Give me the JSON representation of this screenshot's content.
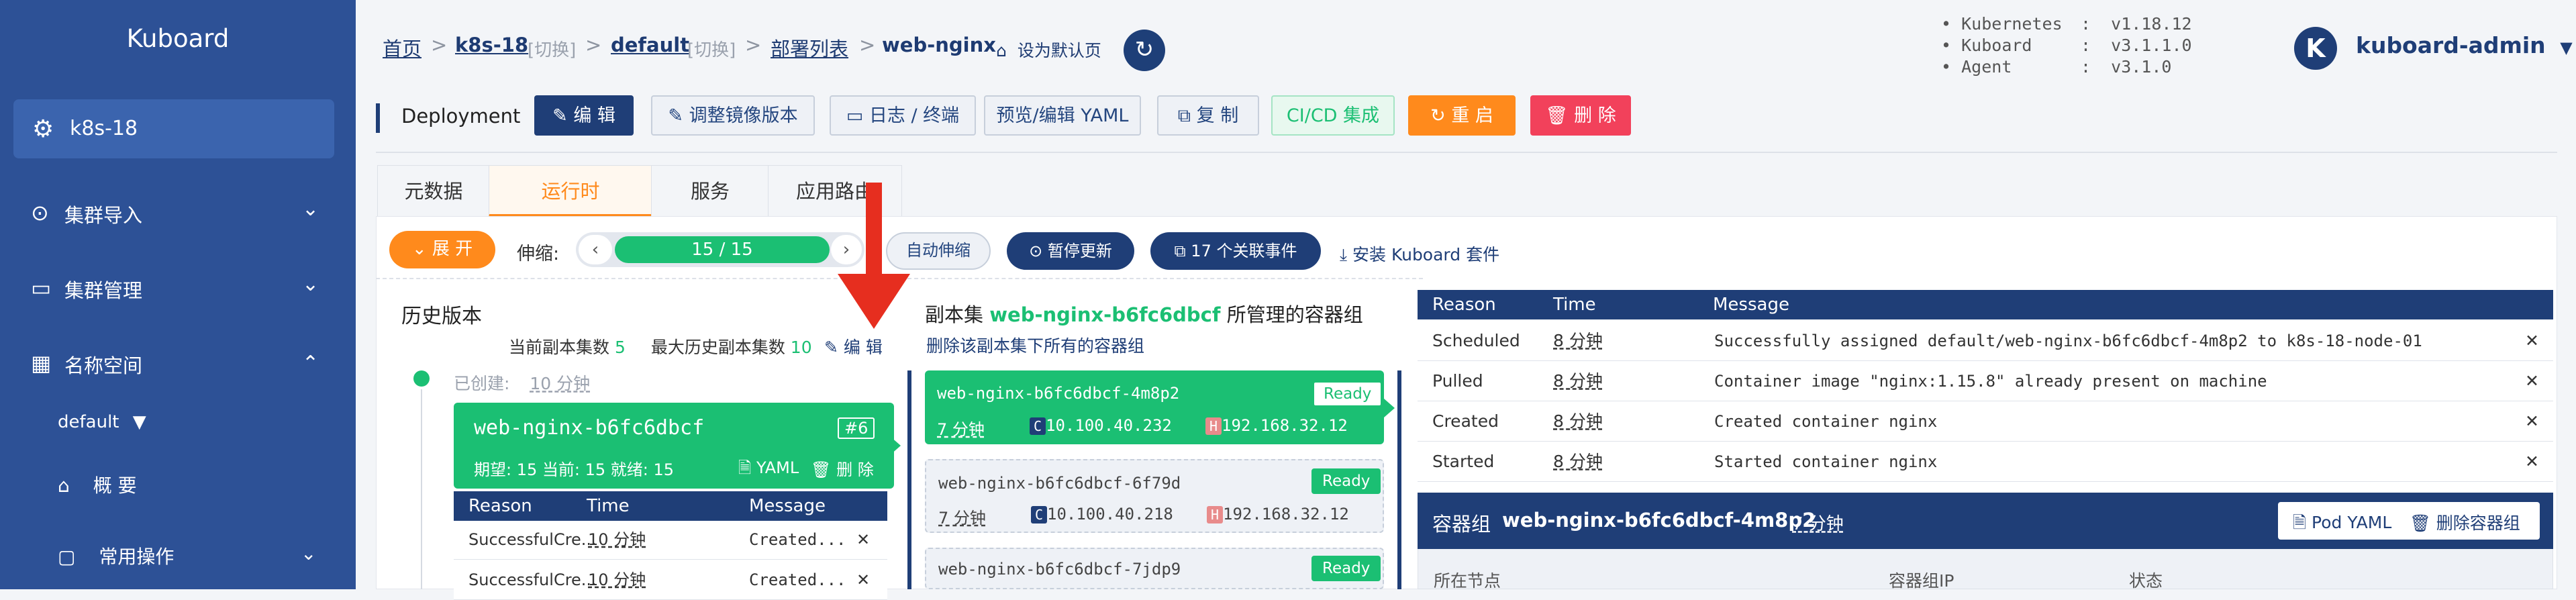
{
  "sidebar": {
    "title": "Kuboard",
    "cluster": "k8s-18",
    "items": [
      {
        "label": "集群导入",
        "icon": "link-icon"
      },
      {
        "label": "集群管理",
        "icon": "server-icon"
      },
      {
        "label": "名称空间",
        "icon": "grid-icon"
      }
    ],
    "namespace": "default",
    "overview": "概 要",
    "common_ops": "常用操作"
  },
  "breadcrumb": {
    "home": "首页",
    "cluster": "k8s-18",
    "switch1": "[切换]",
    "ns": "default",
    "switch2": "[切换]",
    "deploy_list": "部署列表",
    "current": "web-nginx",
    "set_default": "设为默认页"
  },
  "versions": [
    {
      "name": "Kubernetes",
      "value": "v1.18.12"
    },
    {
      "name": "Kuboard",
      "value": "v3.1.1.0"
    },
    {
      "name": "Agent",
      "value": "v3.1.0"
    }
  ],
  "user": {
    "initial": "K",
    "name": "kuboard-admin"
  },
  "toolbar": {
    "kind": "Deployment",
    "edit": "编 辑",
    "image": "调整镜像版本",
    "logs": "日志 / 终端",
    "yaml": "预览/编辑 YAML",
    "copy": "复 制",
    "cicd": "CI/CD 集成",
    "restart": "重 启",
    "delete": "删 除"
  },
  "tabs": [
    "元数据",
    "运行时",
    "服务",
    "应用路由"
  ],
  "runtime": {
    "expand": "展 开",
    "scale_label": "伸缩:",
    "scale_value": "15 / 15",
    "autoscale": "自动伸缩",
    "pause": "暂停更新",
    "events": "17 个关联事件",
    "install": "安装 Kuboard 套件"
  },
  "history": {
    "title": "历史版本",
    "current_label": "当前副本集数",
    "current_value": "5",
    "max_label": "最大历史副本集数",
    "max_value": "10",
    "edit": "编 辑",
    "created_label": "已创建:",
    "created_value": "10 分钟",
    "rs_name": "web-nginx-b6fc6dbcf",
    "rs_rev": "#6",
    "rs_stats": "期望: 15  当前: 15  就绪: 15",
    "rs_yaml": "YAML",
    "rs_delete": "删 除",
    "table_head": [
      "Reason",
      "Time",
      "Message"
    ],
    "rows": [
      {
        "reason": "SuccessfulCre...",
        "time": "10 分钟",
        "message": "Created..."
      },
      {
        "reason": "SuccessfulCre...",
        "time": "10 分钟",
        "message": "Created..."
      }
    ]
  },
  "pods": {
    "title_prefix": "副本集",
    "rs_name": "web-nginx-b6fc6dbcf",
    "title_suffix": "所管理的容器组",
    "delete_all": "删除该副本集下所有的容器组",
    "ready": "Ready",
    "list": [
      {
        "name": "web-nginx-b6fc6dbcf-4m8p2",
        "age": "7 分钟",
        "cip": "10.100.40.232",
        "hip": "192.168.32.12"
      },
      {
        "name": "web-nginx-b6fc6dbcf-6f79d",
        "age": "7 分钟",
        "cip": "10.100.40.218",
        "hip": "192.168.32.12"
      },
      {
        "name": "web-nginx-b6fc6dbcf-7jdp9",
        "age": "",
        "cip": "",
        "hip": ""
      }
    ]
  },
  "events": {
    "head": [
      "Reason",
      "Time",
      "Message"
    ],
    "rows": [
      {
        "reason": "Scheduled",
        "time": "8 分钟",
        "message": "Successfully assigned default/web-nginx-b6fc6dbcf-4m8p2 to k8s-18-node-01"
      },
      {
        "reason": "Pulled",
        "time": "8 分钟",
        "message": "Container image \"nginx:1.15.8\" already present on machine"
      },
      {
        "reason": "Created",
        "time": "8 分钟",
        "message": "Created container nginx"
      },
      {
        "reason": "Started",
        "time": "8 分钟",
        "message": "Started container nginx"
      }
    ]
  },
  "pod_detail": {
    "label": "容器组",
    "name": "web-nginx-b6fc6dbcf-4m8p2",
    "age": "7 分钟",
    "yaml": "Pod YAML",
    "delete": "删除容器组",
    "fields": [
      "所在节点",
      "容器组IP",
      "状态"
    ]
  }
}
